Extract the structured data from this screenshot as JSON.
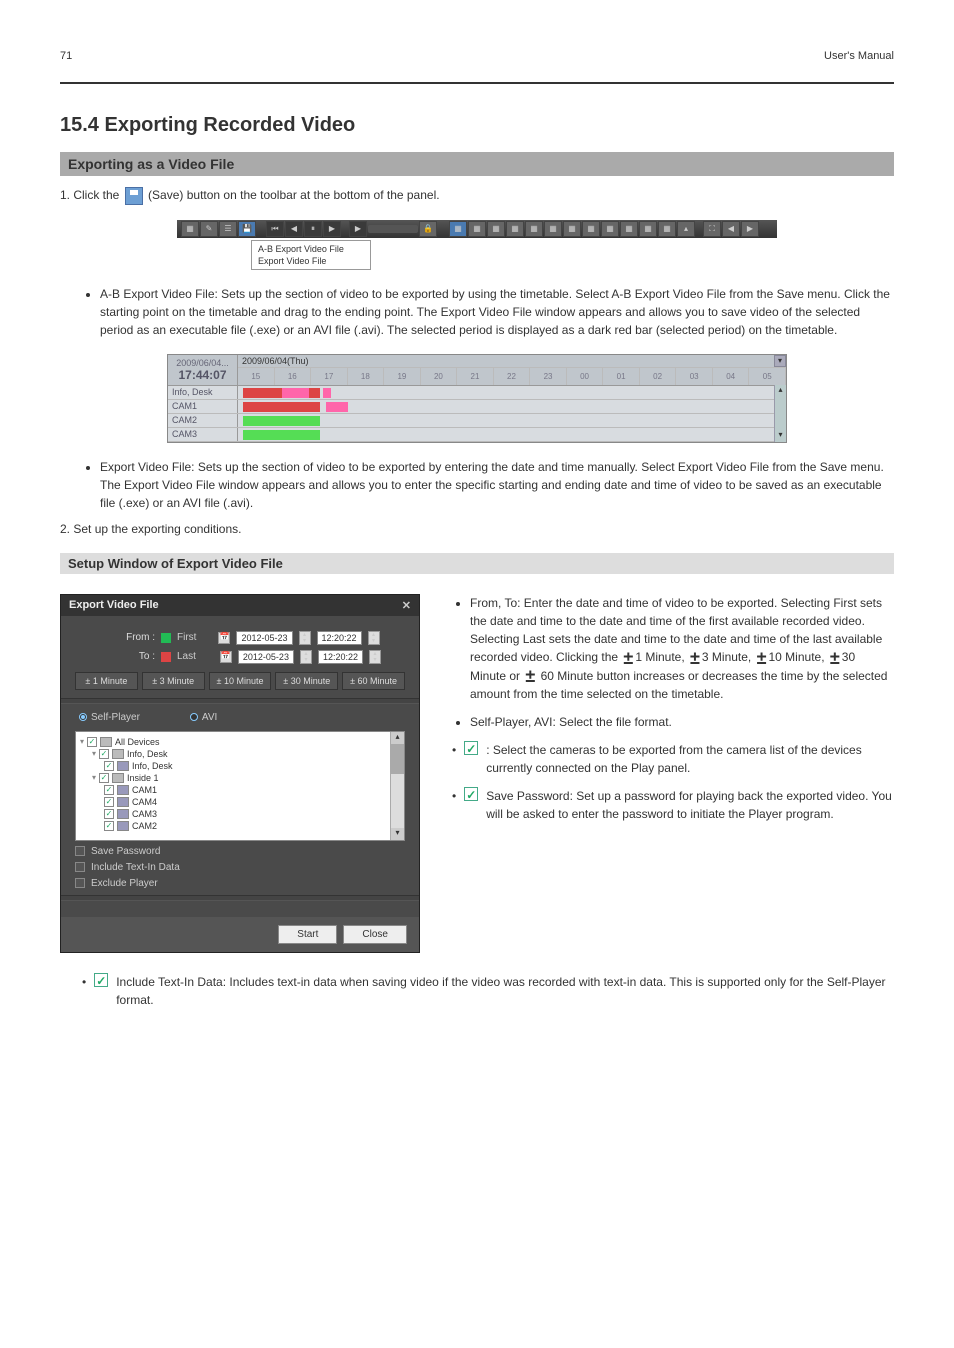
{
  "header": {
    "page": "71",
    "doc_title": "User's Manual"
  },
  "section_title": "15.4   Exporting Recorded Video",
  "sub_exporting_video_file": "Exporting as a Video File",
  "para1_a": "1. Click the ",
  "para1_b": " (Save) button on the toolbar at the bottom of the panel.",
  "toolbar": {
    "menu_items": [
      "A-B Export Video File",
      "Export Video File"
    ]
  },
  "list1": {
    "item1": "A-B Export Video File: Sets up the section of video to be exported by using the timetable. Select A-B Export Video File from the Save menu. Click the starting point on the timetable and drag to the ending point. The Export Video File window appears and allows you to save video of the selected period as an executable file (.exe) or an AVI file (.avi). The selected period is displayed as a dark red bar (selected period) on the timetable.",
    "item2": "Export Video File: Sets up the section of video to be exported by entering the date and time manually. Select Export Video File from the Save menu. The Export Video File window appears and allows you to enter the specific starting and ending date and time of video to be saved as an executable file (.exe) or an AVI file (.avi)."
  },
  "timetable": {
    "date_left": "2009/06/04...",
    "time_left": "17:44:07",
    "date_header": "2009/06/04(Thu)",
    "hours": [
      "15",
      "16",
      "17",
      "18",
      "19",
      "20",
      "21",
      "22",
      "23",
      "00",
      "01",
      "02",
      "03",
      "04",
      "05"
    ],
    "rows": [
      "Info, Desk",
      "CAM1",
      "CAM2",
      "CAM3"
    ]
  },
  "para2": "2. Set up the exporting conditions.",
  "sub_export_window": "Setup Window of Export Video File",
  "dialog": {
    "title": "Export Video File",
    "from": "From :",
    "first": "First",
    "to": "To :",
    "last": "Last",
    "date": "2012-05-23",
    "time": "12:20:22",
    "btns": [
      "± 1 Minute",
      "± 3 Minute",
      "± 10 Minute",
      "± 30 Minute",
      "± 60 Minute"
    ],
    "radio_self": "Self-Player",
    "radio_avi": "AVI",
    "tree": {
      "all": "All Devices",
      "g1": "Info, Desk",
      "g1c1": "Info, Desk",
      "g2": "Inside 1",
      "g2c1": "CAM1",
      "g2c2": "CAM4",
      "g2c3": "CAM3",
      "g2c4": "CAM2"
    },
    "opt1": "Save Password",
    "opt2": "Include Text-In Data",
    "opt3": "Exclude Player",
    "start": "Start",
    "close": "Close"
  },
  "desc": {
    "b1": "From, To: Enter the date and time of video to be exported. Selecting First sets the date and time to the date and time of the first available recorded video. Selecting Last sets the date and time to the date and time of the last available recorded video. Clicking the ",
    "b1_tail": " 60 Minute button increases or decreases the time by the selected amount from the time selected on the timetable.",
    "pm_labels": [
      "1 Minute,",
      "3 Minute,",
      "10 Minute,",
      "30 Minute or"
    ],
    "b2": "Self-Player, AVI: Select the file format.",
    "b3a": " : Select the cameras to be exported from the camera list of the devices currently connected on the Play panel.",
    "b4a": " Save Password: Set up a password for playing back the exported video. You will be asked to enter the password to initiate the Player program.",
    "b5a": " Include Text-In Data: Includes text-in data when saving video if the video was recorded with text-in data. This is supported only for the Self-Player format."
  }
}
